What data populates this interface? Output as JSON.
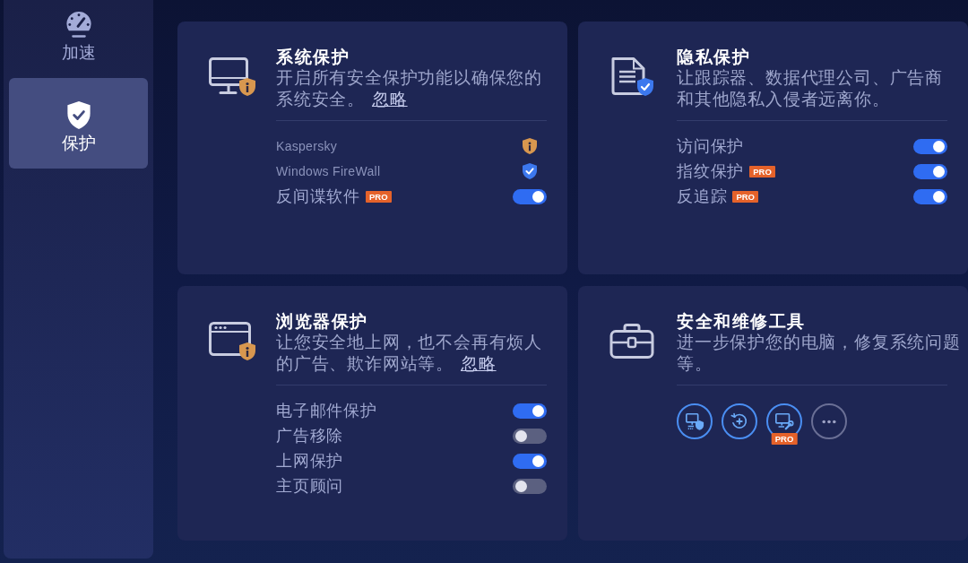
{
  "sidebar": {
    "items": [
      {
        "label": "加速",
        "selected": false
      },
      {
        "label": "保护",
        "selected": true
      }
    ]
  },
  "cards": [
    {
      "title": "系统保护",
      "protected": false,
      "description_lines": [
        "开启所有安全保护功能以确保您的",
        "系统安全。"
      ],
      "link": "忽略",
      "rows": [
        {
          "kind": "status",
          "label": "Kaspersky",
          "protected": false
        },
        {
          "kind": "status",
          "label": "Windows FireWall",
          "protected": true
        },
        {
          "kind": "toggle",
          "label": "反间谍软件",
          "badge": "PRO",
          "on": true
        }
      ]
    },
    {
      "title": "隐私保护",
      "protected": true,
      "description_lines": [
        "让跟踪器、数据代理公司、广告商",
        "和其他隐私入侵者远离你。"
      ],
      "rows": [
        {
          "kind": "toggle",
          "label": "访问保护",
          "on": true
        },
        {
          "kind": "toggle",
          "label": "指纹保护",
          "badge": "PRO",
          "on": true
        },
        {
          "kind": "toggle",
          "label": "反追踪",
          "badge": "PRO",
          "on": true
        }
      ]
    },
    {
      "title": "浏览器保护",
      "protected": false,
      "description_lines": [
        "让您安全地上网，也不会再有烦人",
        "的广告、欺诈网站等。"
      ],
      "link": "忽略",
      "rows": [
        {
          "kind": "toggle",
          "label": "电子邮件保护",
          "on": true
        },
        {
          "kind": "toggle",
          "label": "广告移除",
          "on": false
        },
        {
          "kind": "toggle",
          "label": "上网保护",
          "on": true
        },
        {
          "kind": "toggle",
          "label": "主页顾问",
          "on": false
        }
      ]
    },
    {
      "title": "安全和维修工具",
      "description_lines": [
        "进一步保护您的电脑，修复系统问题",
        "等。"
      ],
      "tools": [
        {
          "kind": "tool"
        },
        {
          "kind": "tool"
        },
        {
          "kind": "tool",
          "badge": "PRO"
        },
        {
          "kind": "more"
        }
      ]
    }
  ]
}
